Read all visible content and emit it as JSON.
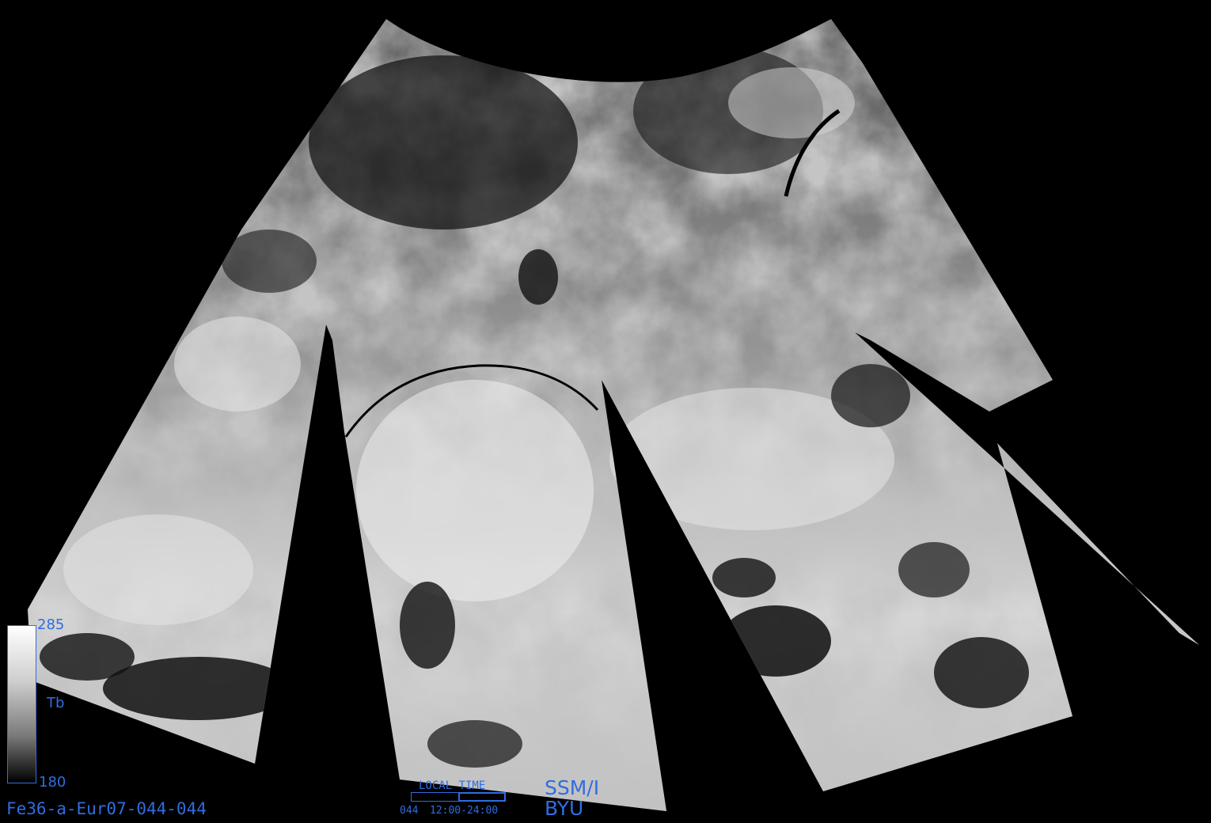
{
  "map": {
    "sensor": "SSM/I",
    "coverage": "Europe",
    "colormap": "grayscale",
    "background_color": "#000000",
    "label_color": "#2f6de0"
  },
  "legend": {
    "variable": "Tb",
    "max": "285",
    "min": "180"
  },
  "image_id": "Fe36-a-Eur07-044-044",
  "time_widget": {
    "label": "LOCAL TIME",
    "day": "044",
    "range": "12:00-24:00",
    "window_start_fraction": 0.5,
    "window_end_fraction": 1.0
  },
  "credit": {
    "line1": "SSM/I",
    "line2": "BYU"
  }
}
